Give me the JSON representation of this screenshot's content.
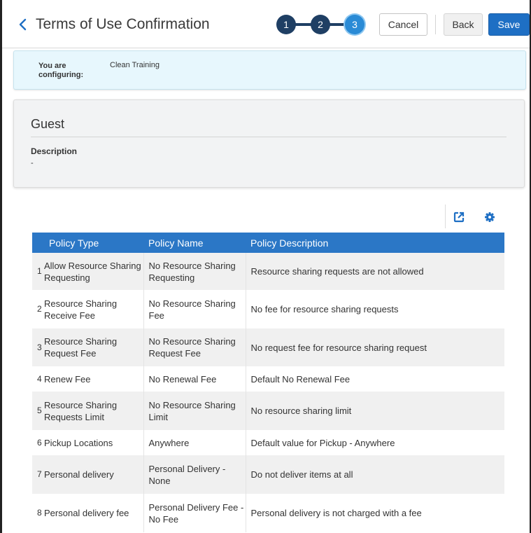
{
  "header": {
    "title": "Terms of Use Confirmation",
    "steps": [
      "1",
      "2",
      "3"
    ],
    "active_step": 3,
    "cancel_label": "Cancel",
    "back_label": "Back",
    "save_label": "Save"
  },
  "configuring": {
    "label": "You are configuring:",
    "value": "Clean Training"
  },
  "guest": {
    "title": "Guest",
    "description_label": "Description",
    "description_value": "-"
  },
  "toolbar": {
    "icons": [
      "export-icon",
      "gear-icon"
    ]
  },
  "table": {
    "columns": [
      "Policy Type",
      "Policy Name",
      "Policy Description"
    ],
    "rows": [
      {
        "index": "1",
        "type": "Allow Resource Sharing Requesting",
        "name": "No Resource Sharing Requesting",
        "description": "Resource sharing requests are not allowed"
      },
      {
        "index": "2",
        "type": "Resource Sharing Receive Fee",
        "name": "No Resource Sharing Fee",
        "description": "No fee for resource sharing requests"
      },
      {
        "index": "3",
        "type": "Resource Sharing Request Fee",
        "name": "No Resource Sharing Request Fee",
        "description": "No request fee for resource sharing request"
      },
      {
        "index": "4",
        "type": "Renew Fee",
        "name": "No Renewal Fee",
        "description": "Default No Renewal Fee"
      },
      {
        "index": "5",
        "type": "Resource Sharing Requests Limit",
        "name": "No Resource Sharing Limit",
        "description": "No resource sharing limit"
      },
      {
        "index": "6",
        "type": "Pickup Locations",
        "name": "Anywhere",
        "description": "Default value for Pickup - Anywhere"
      },
      {
        "index": "7",
        "type": "Personal delivery",
        "name": "Personal Delivery - None",
        "description": "Do not deliver items at all"
      },
      {
        "index": "8",
        "type": "Personal delivery fee",
        "name": "Personal Delivery Fee - No Fee",
        "description": "Personal delivery is not charged with a fee"
      }
    ]
  },
  "colors": {
    "accent": "#1e6fc4",
    "table_header": "#2b77c6",
    "stepper": "#1f3f64",
    "stepper_active": "#2a8bd6",
    "config_bg": "#e7f7fd"
  }
}
